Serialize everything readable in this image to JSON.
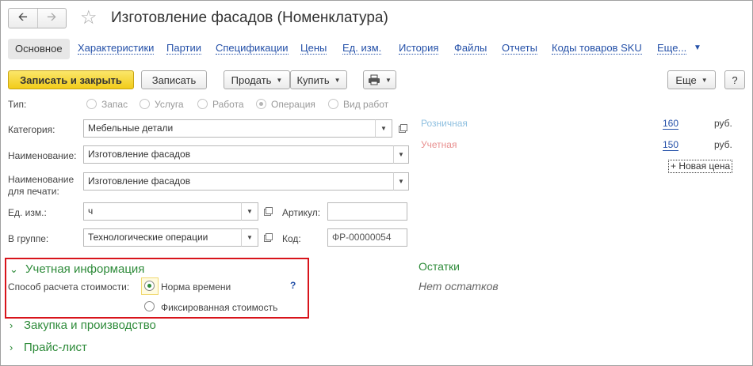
{
  "window": {
    "title": "Изготовление фасадов (Номенклатура)"
  },
  "nav": {
    "back_icon": "arrow-left-icon",
    "forward_icon": "arrow-right-icon",
    "star_icon": "star-icon"
  },
  "tabs": [
    {
      "label": "Основное"
    },
    {
      "label": "Характеристики"
    },
    {
      "label": "Партии"
    },
    {
      "label": "Спецификации"
    },
    {
      "label": "Цены"
    },
    {
      "label": "Ед. изм."
    },
    {
      "label": "История"
    },
    {
      "label": "Файлы"
    },
    {
      "label": "Отчеты"
    },
    {
      "label": "Коды товаров SKU"
    },
    {
      "label": "Еще..."
    }
  ],
  "toolbar": {
    "save_close": "Записать и закрыть",
    "save": "Записать",
    "sell": "Продать",
    "buy": "Купить",
    "print_icon": "printer-icon",
    "more": "Еще",
    "help": "?"
  },
  "form": {
    "type_label": "Тип:",
    "type_options": [
      "Запас",
      "Услуга",
      "Работа",
      "Операция",
      "Вид работ"
    ],
    "type_selected": "Операция",
    "category_label": "Категория:",
    "category_value": "Мебельные детали",
    "name_label": "Наименование:",
    "name_value": "Изготовление фасадов",
    "print_name_label_1": "Наименование",
    "print_name_label_2": "для печати:",
    "print_name_value": "Изготовление фасадов",
    "unit_label": "Ед. изм.:",
    "unit_value": "ч",
    "article_label": "Артикул:",
    "article_value": "",
    "group_label": "В группе:",
    "group_value": "Технологические операции",
    "code_label": "Код:",
    "code_value": "ФР-00000054"
  },
  "prices": {
    "retail_label": "Розничная",
    "retail_value": "160",
    "accounting_label": "Учетная",
    "accounting_value": "150",
    "currency": "руб.",
    "new_price": "+ Новая цена"
  },
  "accounting": {
    "section_title": "Учетная информация",
    "cost_method_label": "Способ расчета стоимости:",
    "option_norm": "Норма времени",
    "option_fixed": "Фиксированная стоимость",
    "selected": "Норма времени",
    "help": "?"
  },
  "sections": {
    "purchase": "Закупка и производство",
    "price_list": "Прайс-лист"
  },
  "stock": {
    "title": "Остатки",
    "empty": "Нет остатков"
  },
  "colors": {
    "accent_green": "#2e8b3a",
    "link_blue": "#2450a8",
    "highlight_red": "#d8141b",
    "save_yellow": "#f2cc1a",
    "retail_color": "#8fc0e0",
    "accounting_color": "#e89090"
  }
}
